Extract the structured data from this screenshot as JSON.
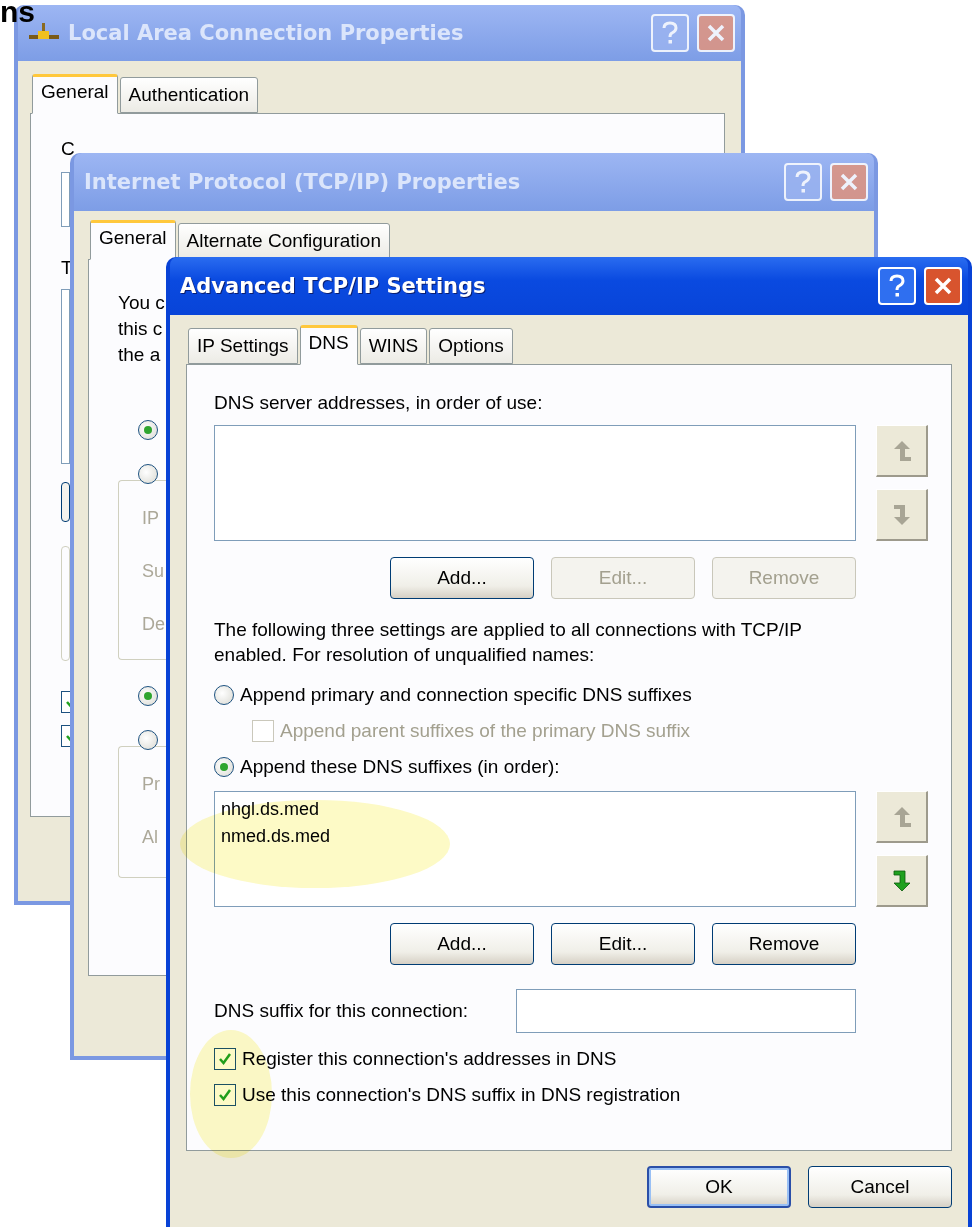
{
  "slide_title_fragment": "ns",
  "local_area": {
    "title": "Local Area Connection Properties",
    "active": false,
    "tabs": [
      {
        "label": "General",
        "selected": true
      },
      {
        "label": "Authentication",
        "selected": false
      }
    ],
    "fragments": [
      "C",
      "T"
    ],
    "checkboxes": [
      {
        "checked": true
      },
      {
        "checked": true
      }
    ]
  },
  "tcpip": {
    "title": "Internet Protocol (TCP/IP) Properties",
    "active": false,
    "tabs": [
      {
        "label": "General",
        "selected": true
      },
      {
        "label": "Alternate Configuration",
        "selected": false
      }
    ],
    "intro_lines": [
      "You c",
      "this c",
      "the a"
    ],
    "groups": [
      {
        "radios": [
          {
            "selected": true
          },
          {
            "selected": false
          }
        ],
        "fields": [
          "IP",
          "Su",
          "De"
        ]
      },
      {
        "radios": [
          {
            "selected": true
          },
          {
            "selected": false
          }
        ],
        "fields": [
          "Pr",
          "Al"
        ]
      }
    ]
  },
  "advanced": {
    "title": "Advanced TCP/IP Settings",
    "active": true,
    "tabs": [
      {
        "label": "IP Settings",
        "selected": false
      },
      {
        "label": "DNS",
        "selected": true
      },
      {
        "label": "WINS",
        "selected": false
      },
      {
        "label": "Options",
        "selected": false
      }
    ],
    "servers": {
      "label": "DNS server addresses, in order of use:",
      "up_disabled": true,
      "down_disabled": true,
      "buttons": [
        {
          "label": "Add...",
          "disabled": false
        },
        {
          "label": "Edit...",
          "disabled": true
        },
        {
          "label": "Remove",
          "disabled": true
        }
      ]
    },
    "note": "The following three settings are applied to all connections with TCP/IP enabled. For resolution of unqualified names:",
    "options": [
      {
        "kind": "radio",
        "label": "Append primary and connection specific DNS suffixes",
        "selected": false
      },
      {
        "kind": "checkbox",
        "label": "Append parent suffixes of the primary DNS suffix",
        "checked": false,
        "disabled": true
      },
      {
        "kind": "radio",
        "label": "Append these DNS suffixes (in order):",
        "selected": true
      }
    ],
    "suffixes": {
      "items": [
        "nhgl.ds.med",
        "nmed.ds.med"
      ],
      "up_disabled": true,
      "down_disabled": false,
      "buttons": [
        {
          "label": "Add...",
          "disabled": false
        },
        {
          "label": "Edit...",
          "disabled": false
        },
        {
          "label": "Remove",
          "disabled": false
        }
      ]
    },
    "connection_suffix": {
      "label": "DNS suffix for this connection:"
    },
    "checks": [
      {
        "label": "Register this connection's addresses in DNS",
        "checked": true
      },
      {
        "label": "Use this connection's DNS suffix in DNS registration",
        "checked": true
      }
    ],
    "footer_buttons": [
      {
        "label": "OK",
        "default": true
      },
      {
        "label": "Cancel",
        "default": false
      }
    ]
  }
}
